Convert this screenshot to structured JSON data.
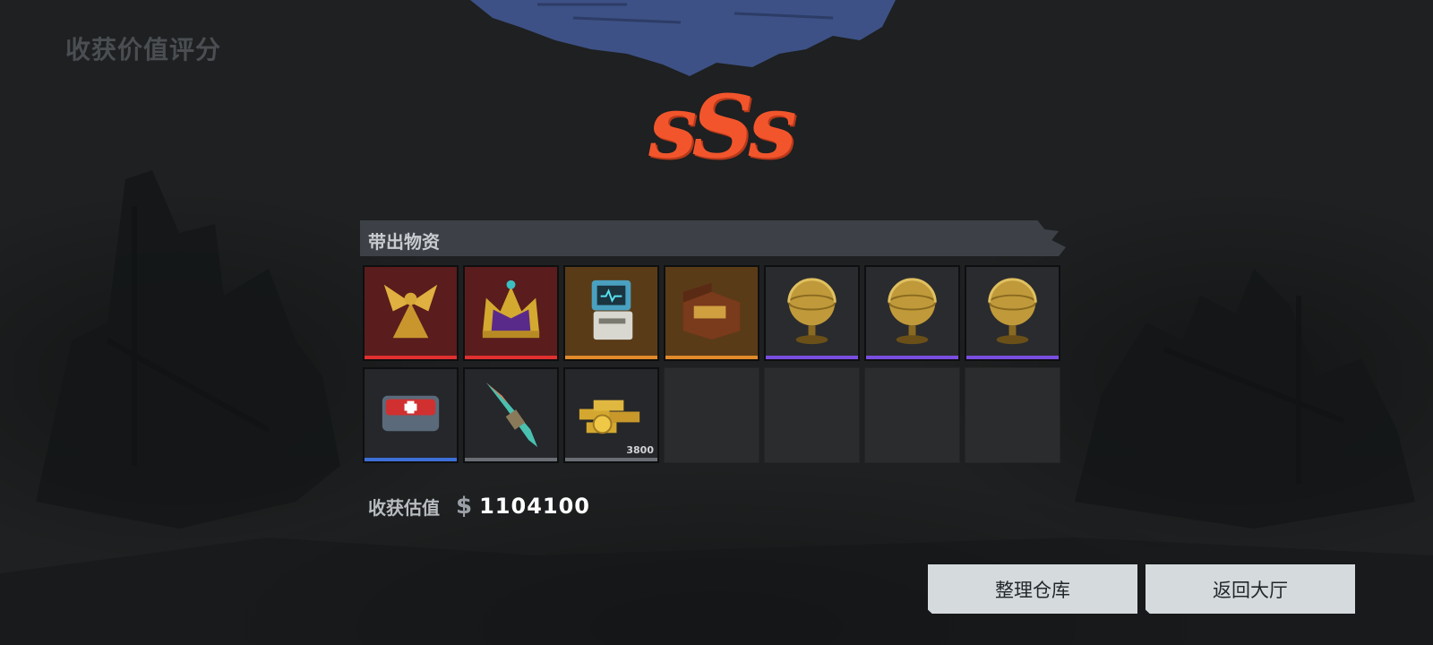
{
  "screen": {
    "title": "收获价值评分",
    "rank": "sSs"
  },
  "loot": {
    "section_label": "带出物资",
    "items": [
      {
        "name": "golden-angel-statue-icon",
        "rarity": "red",
        "rarity_color": "#e03030",
        "bg": "#5a1c1c"
      },
      {
        "name": "royal-crown-icon",
        "rarity": "red",
        "rarity_color": "#e03030",
        "bg": "#5a1c1c"
      },
      {
        "name": "portable-device-icon",
        "rarity": "orange",
        "rarity_color": "#e08a2a",
        "bg": "#5a3b17"
      },
      {
        "name": "music-box-icon",
        "rarity": "orange",
        "rarity_color": "#e08a2a",
        "bg": "#5a3b17"
      },
      {
        "name": "golden-globe-icon",
        "rarity": "purple",
        "rarity_color": "#7a4ee0",
        "bg": "#2a2b2e"
      },
      {
        "name": "golden-globe-icon",
        "rarity": "purple",
        "rarity_color": "#7a4ee0",
        "bg": "#2a2b2e"
      },
      {
        "name": "golden-globe-icon",
        "rarity": "purple",
        "rarity_color": "#7a4ee0",
        "bg": "#2a2b2e"
      },
      {
        "name": "medkit-case-icon",
        "rarity": "blue",
        "rarity_color": "#3d6fd8",
        "bg": "#25272a"
      },
      {
        "name": "crystal-shard-icon",
        "rarity": "gray",
        "rarity_color": "#6a6e74",
        "bg": "#25272a"
      },
      {
        "name": "gold-bars-coins-icon",
        "rarity": "gray",
        "rarity_color": "#6a6e74",
        "bg": "#25272a",
        "quantity": "3800"
      }
    ],
    "empty_slots": 4
  },
  "valuation": {
    "label": "收获估值",
    "currency_symbol": "$",
    "amount": "1104100"
  },
  "buttons": {
    "warehouse": "整理仓库",
    "lobby": "返回大厅"
  }
}
